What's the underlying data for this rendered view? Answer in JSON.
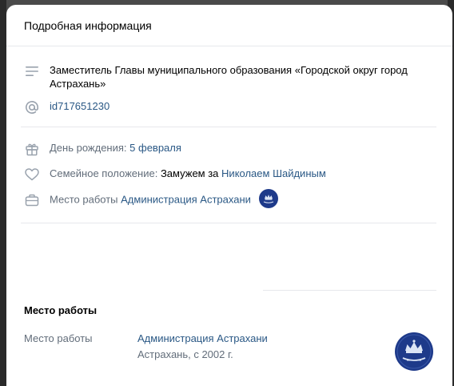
{
  "modal": {
    "title": "Подробная информация"
  },
  "details": {
    "status": "Заместитель Главы муниципального образования «Городской округ город Астрахань»",
    "short_id": "id717651230",
    "birthday_label": "День рождения:",
    "birthday_value": "5 февраля",
    "family_label": "Семейное положение:",
    "family_text": "Замужем за",
    "family_spouse": "Николаем Шайдиным",
    "work_label": "Место работы",
    "work_value": "Администрация Астрахани"
  },
  "career": {
    "section_title": "Место работы",
    "label": "Место работы",
    "organization": "Администрация Астрахани",
    "details": "Астрахань, с 2002 г."
  },
  "icons": {
    "status": "lines-icon",
    "short_id": "at-sign-icon",
    "birthday": "gift-icon",
    "family": "heart-icon",
    "work": "briefcase-icon",
    "emblem": "astrakhan-emblem"
  },
  "colors": {
    "link": "#2a5885",
    "muted": "#626d7a",
    "icon": "#99a2ad",
    "emblem_bg": "#1e3a8a"
  }
}
